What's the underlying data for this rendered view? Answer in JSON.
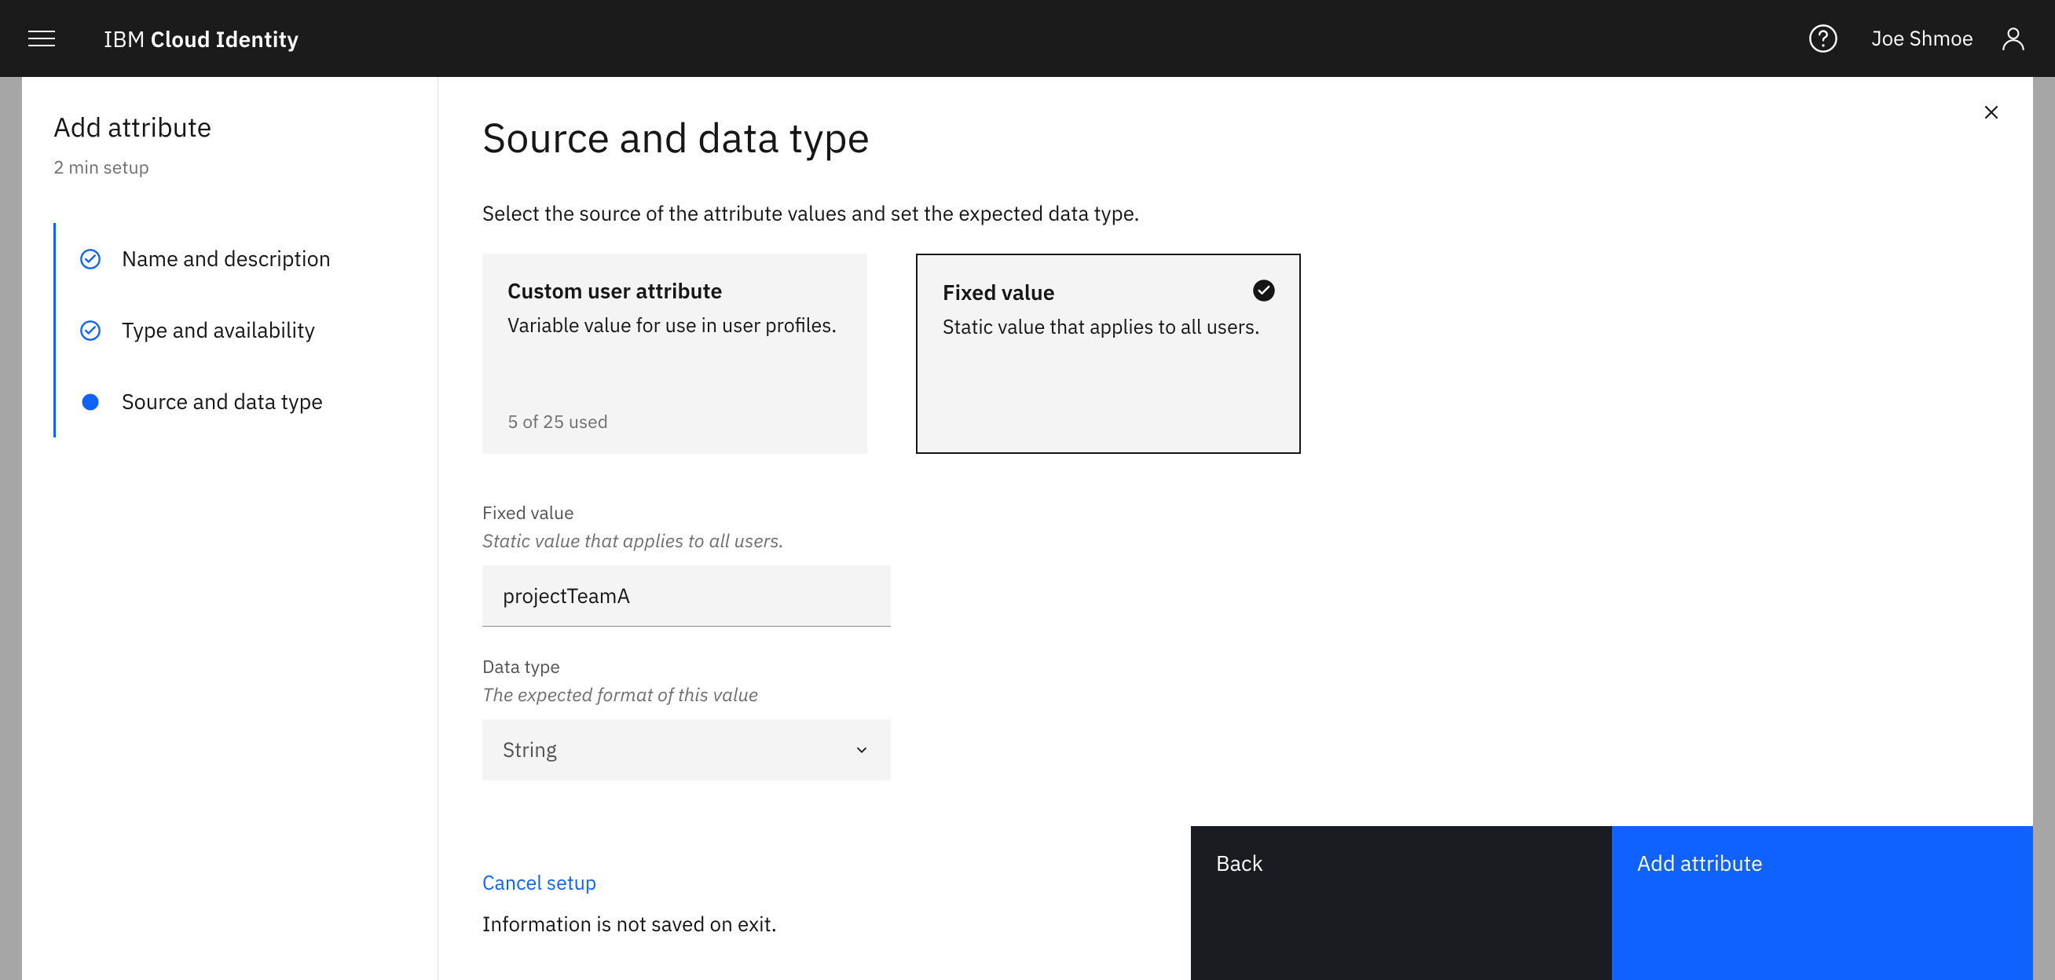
{
  "header": {
    "brand_prefix": "IBM",
    "brand_suffix": "Cloud Identity",
    "username": "Joe Shmoe"
  },
  "sidebar": {
    "title": "Add attribute",
    "subtitle": "2 min setup",
    "steps": [
      {
        "label": "Name and description",
        "state": "done"
      },
      {
        "label": "Type and availability",
        "state": "done"
      },
      {
        "label": "Source and data type",
        "state": "current"
      }
    ]
  },
  "main": {
    "heading": "Source and data type",
    "lead": "Select the source of the attribute values and set the expected data type.",
    "tiles": [
      {
        "title": "Custom user attribute",
        "desc": "Variable value for use in user profiles.",
        "footnote": "5 of 25 used",
        "selected": false
      },
      {
        "title": "Fixed value",
        "desc": "Static value that applies to all users.",
        "footnote": "",
        "selected": true
      }
    ],
    "fixed_value": {
      "label": "Fixed value",
      "desc": "Static value that applies to all users.",
      "value": "projectTeamA"
    },
    "data_type": {
      "label": "Data type",
      "desc": "The expected format of this value",
      "value": "String"
    }
  },
  "footer": {
    "cancel": "Cancel setup",
    "note": "Information is not saved on exit.",
    "back": "Back",
    "primary": "Add attribute"
  }
}
